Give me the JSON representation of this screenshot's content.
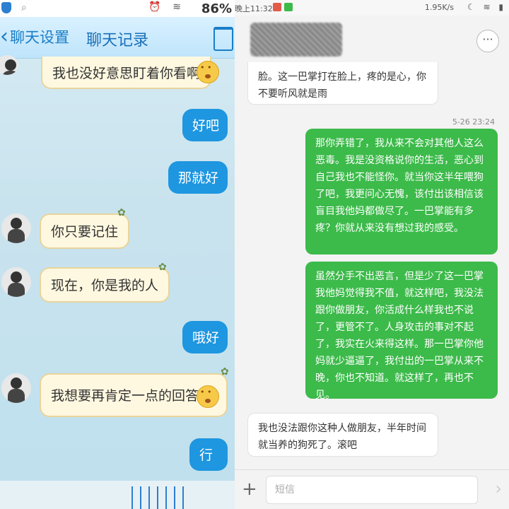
{
  "left": {
    "status": {
      "battery": "86%",
      "net": "3G"
    },
    "header": {
      "back": "聊天设置",
      "title": "聊天记录"
    },
    "messages": [
      {
        "side": "left",
        "text": "我也没好意思盯着你看啊"
      },
      {
        "side": "right",
        "text": "好吧"
      },
      {
        "side": "right",
        "text": "那就好"
      },
      {
        "side": "left",
        "text": "你只要记住"
      },
      {
        "side": "left",
        "text": "现在，你是我的人"
      },
      {
        "side": "right",
        "text": "哦好"
      },
      {
        "side": "left",
        "text": "我想要再肯定一点的回答"
      },
      {
        "side": "right",
        "text": "行"
      }
    ]
  },
  "right": {
    "status": {
      "time": "晚上11:32",
      "speed": "1.95K/s"
    },
    "timestamp": "5-26 23:24",
    "messages": [
      {
        "side": "left",
        "text": "脸。这一巴掌打在脸上，疼的是心，你不要听风就是雨"
      },
      {
        "side": "right",
        "text": "那你弄错了，我从来不会对其他人这么恶毒。我是没资格说你的生活，恶心到自己我也不能怪你。就当你这半年喂狗了吧，我更问心无愧，该付出该相信该盲目我他妈都做尽了。一巴掌能有多疼？你就从来没有想过我的感受。"
      },
      {
        "side": "right",
        "text": "虽然分手不出恶言，但是少了这一巴掌我他妈觉得我不值，就这样吧，我没法跟你做朋友，你活成什么样我也不说了，更管不了。人身攻击的事对不起了，我实在火来得这样。那一巴掌你他妈就少逼逼了，我付出的一巴掌从来不晚，你也不知道。就这样了，再也不见。"
      },
      {
        "side": "left",
        "text": "我也没法跟你这种人做朋友，半年时间就当养的狗死了。滚吧"
      }
    ],
    "input": {
      "placeholder": "短信"
    }
  }
}
